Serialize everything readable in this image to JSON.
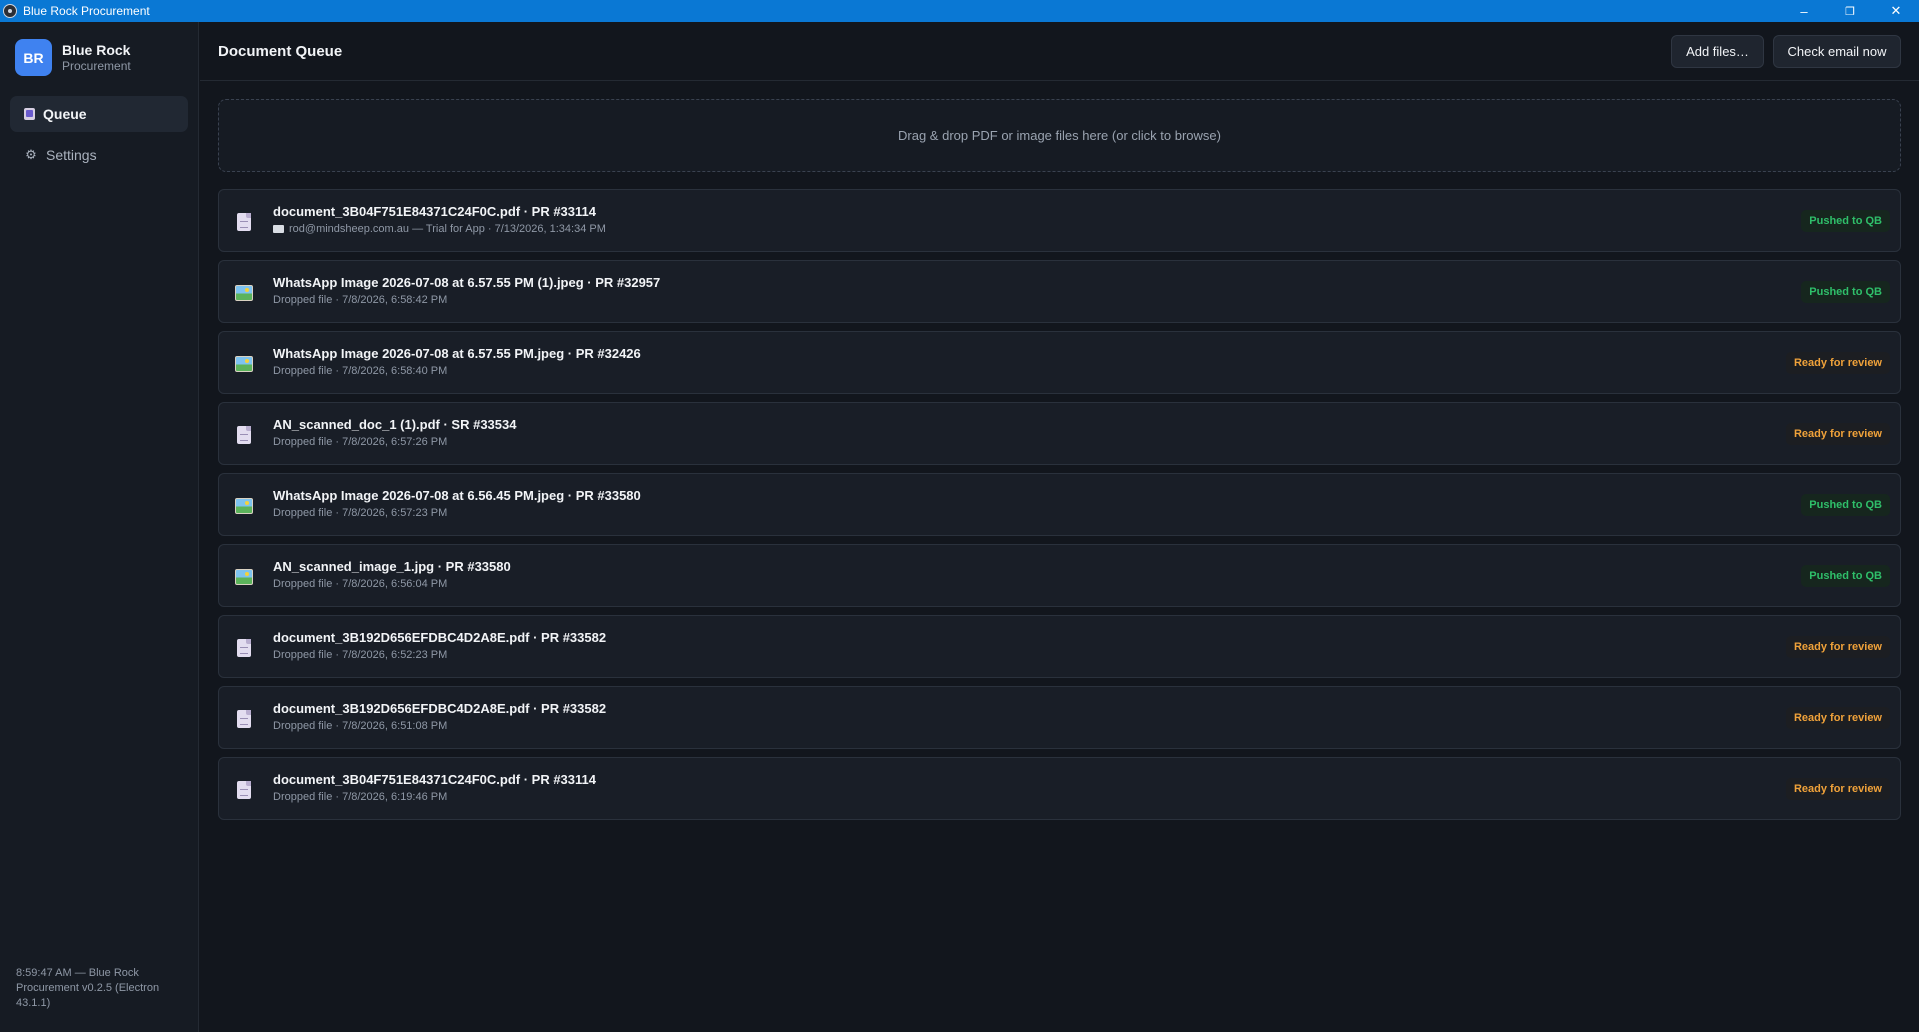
{
  "window": {
    "title": "Blue Rock Procurement",
    "minimize": "–",
    "restore": "❐",
    "close": "✕"
  },
  "sidebar": {
    "brand_initials": "BR",
    "brand_name": "Blue Rock",
    "brand_sub": "Procurement",
    "items": [
      {
        "label": "Queue",
        "icon": "clipboard-icon",
        "active": true
      },
      {
        "label": "Settings",
        "icon": "gear-icon",
        "active": false
      }
    ],
    "footer": "8:59:47 AM — Blue Rock Procurement v0.2.5 (Electron 43.1.1)"
  },
  "header": {
    "title": "Document Queue",
    "add_files_label": "Add files…",
    "check_email_label": "Check email now"
  },
  "dropzone": {
    "text": "Drag & drop PDF or image files here (or click to browse)"
  },
  "documents": [
    {
      "type": "doc",
      "title": "document_3B04F751E84371C24F0C.pdf · PR #33114",
      "subtitle": "rod@mindsheep.com.au — Trial for App · 7/13/2026, 1:34:34 PM",
      "from_email": true,
      "status": "Pushed to QB",
      "status_kind": "pushed"
    },
    {
      "type": "image",
      "title": "WhatsApp Image 2026-07-08 at 6.57.55 PM (1).jpeg · PR #32957",
      "subtitle": "Dropped file · 7/8/2026, 6:58:42 PM",
      "from_email": false,
      "status": "Pushed to QB",
      "status_kind": "pushed"
    },
    {
      "type": "image",
      "title": "WhatsApp Image 2026-07-08 at 6.57.55 PM.jpeg · PR #32426",
      "subtitle": "Dropped file · 7/8/2026, 6:58:40 PM",
      "from_email": false,
      "status": "Ready for review",
      "status_kind": "review"
    },
    {
      "type": "doc",
      "title": "AN_scanned_doc_1 (1).pdf · SR #33534",
      "subtitle": "Dropped file · 7/8/2026, 6:57:26 PM",
      "from_email": false,
      "status": "Ready for review",
      "status_kind": "review"
    },
    {
      "type": "image",
      "title": "WhatsApp Image 2026-07-08 at 6.56.45 PM.jpeg · PR #33580",
      "subtitle": "Dropped file · 7/8/2026, 6:57:23 PM",
      "from_email": false,
      "status": "Pushed to QB",
      "status_kind": "pushed"
    },
    {
      "type": "image",
      "title": "AN_scanned_image_1.jpg · PR #33580",
      "subtitle": "Dropped file · 7/8/2026, 6:56:04 PM",
      "from_email": false,
      "status": "Pushed to QB",
      "status_kind": "pushed"
    },
    {
      "type": "doc",
      "title": "document_3B192D656EFDBC4D2A8E.pdf · PR #33582",
      "subtitle": "Dropped file · 7/8/2026, 6:52:23 PM",
      "from_email": false,
      "status": "Ready for review",
      "status_kind": "review"
    },
    {
      "type": "doc",
      "title": "document_3B192D656EFDBC4D2A8E.pdf · PR #33582",
      "subtitle": "Dropped file · 7/8/2026, 6:51:08 PM",
      "from_email": false,
      "status": "Ready for review",
      "status_kind": "review"
    },
    {
      "type": "doc",
      "title": "document_3B04F751E84371C24F0C.pdf · PR #33114",
      "subtitle": "Dropped file · 7/8/2026, 6:19:46 PM",
      "from_email": false,
      "status": "Ready for review",
      "status_kind": "review"
    }
  ],
  "colors": {
    "accent": "#0a78d4",
    "brand": "#3f82f0",
    "pushed": "#2fbf6a",
    "review": "#f0a23a"
  }
}
